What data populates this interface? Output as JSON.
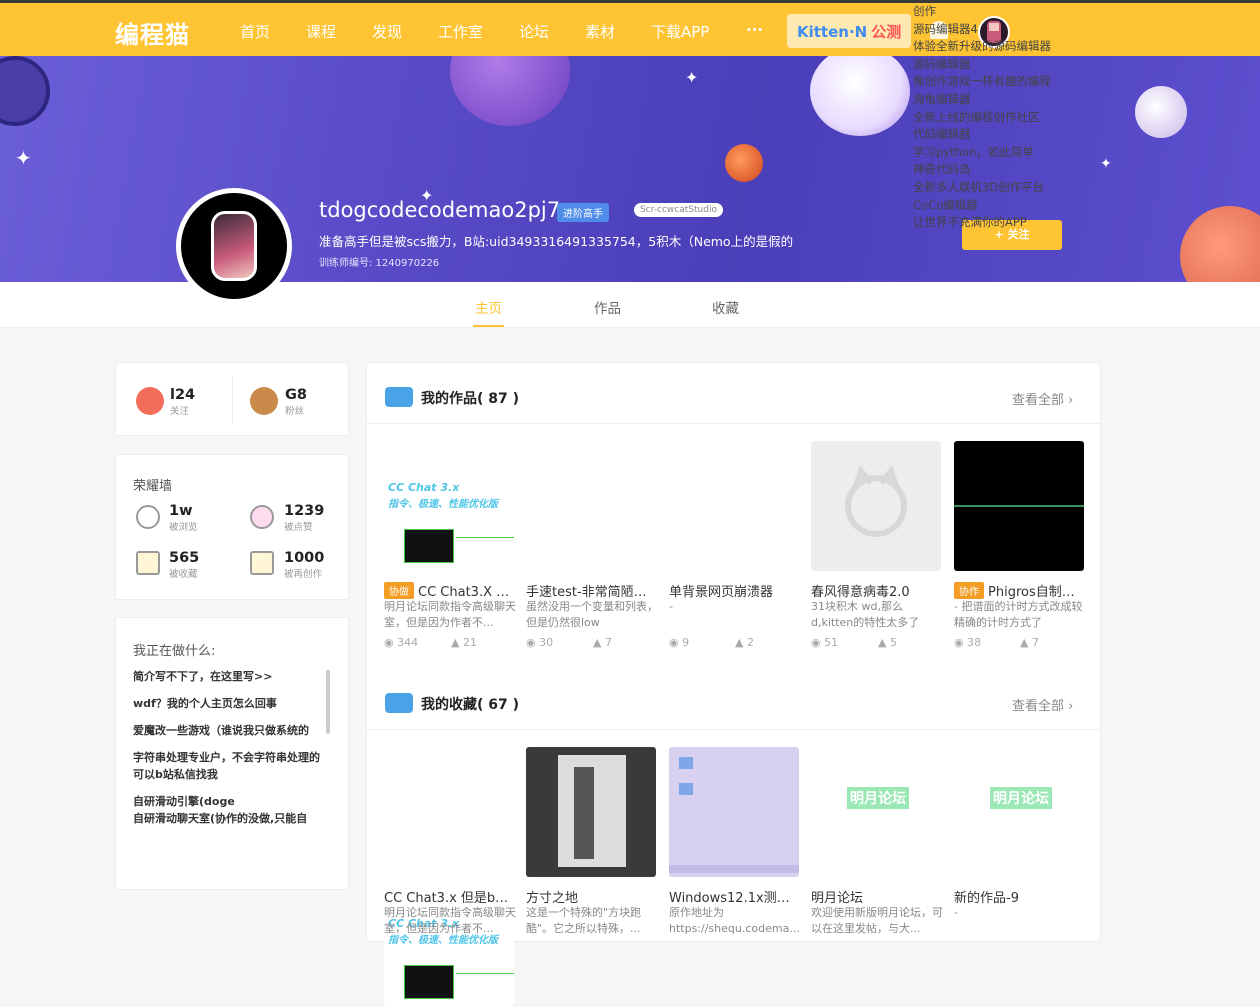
{
  "nav": {
    "logo": "编程猫",
    "items": [
      "首页",
      "课程",
      "发现",
      "工作室",
      "论坛",
      "素材",
      "下载APP",
      "···"
    ],
    "kitten": "Kitten·N",
    "kitten_tag": "公测"
  },
  "dropdown": [
    "创作",
    "源码编辑器4",
    "体验全新升级的源码编辑器",
    "源码编辑器",
    "像创作游戏一样有趣的编程",
    "海龟编辑器",
    "全新上线的编程创作社区",
    "代码编辑器",
    "学习python，如此简单",
    "神奇代码岛",
    "全新多人联机3D创作平台",
    "CoCo编辑器",
    "让世界不充满你的APP"
  ],
  "profile": {
    "username": "tdogcodecodemao2pj7",
    "level_badge": "进阶高手",
    "studio_badge": "Scr-ccwcatStudio",
    "motto": "准备高手但是被scs搬力，B站:uid3493316491335754，5积木（Nemo上的是假的",
    "trainer_id": "训练师编号: 1240970226",
    "follow_btn": "+ 关注"
  },
  "tabs": [
    "主页",
    "作品",
    "收藏"
  ],
  "follow_stats": {
    "following": {
      "num": "l24",
      "label": "关注"
    },
    "fans": {
      "num": "G8",
      "label": "粉丝"
    }
  },
  "honor": {
    "title": "荣耀墙",
    "items": [
      {
        "num": "1w",
        "label": "被浏览"
      },
      {
        "num": "1239",
        "label": "被点赞"
      },
      {
        "num": "565",
        "label": "被收藏"
      },
      {
        "num": "1000",
        "label": "被再创作"
      }
    ]
  },
  "doing": {
    "title": "我正在做什么:",
    "items": [
      "简介写不下了，在这里写>>",
      "wdf？我的个人主页怎么回事",
      "爱魔改一些游戏（谁说我只做系统的",
      "字符串处理专业户，不会字符串处理的可以b站私信找我",
      "自研滑动引擎(doge",
      "自研滑动聊天室(协作的没做,只能自"
    ]
  },
  "works": {
    "title": "我的作品( 87 )",
    "view_all": "查看全部",
    "items": [
      {
        "tag": "协做",
        "title": "CC Chat3.X 但...",
        "desc": "明月论坛同款指令高级聊天室，但是因为作者不...",
        "views": "344",
        "likes": "21",
        "cc1": "CC Chat 3.x",
        "cc2": "指令、极速、性能优化版"
      },
      {
        "tag": "",
        "title": "手速test-非常简陋且...",
        "desc": "虽然没用一个变量和列表，但是仍然很low",
        "views": "30",
        "likes": "7"
      },
      {
        "tag": "",
        "title": "单背景网页崩溃器",
        "desc": "-",
        "views": "9",
        "likes": "2"
      },
      {
        "tag": "",
        "title": "春风得意病毒2.0",
        "desc": "31块积木 wd,那么d,kitten的特性太多了",
        "views": "51",
        "likes": "5"
      },
      {
        "tag": "协作",
        "title": "Phigros自制烂...",
        "desc": "- 把谱面的计时方式改成较精确的计时方式了",
        "views": "38",
        "likes": "7"
      }
    ]
  },
  "favs": {
    "title": "我的收藏( 67 )",
    "view_all": "查看全部",
    "items": [
      {
        "title": "CC Chat3.x 但是bug...",
        "desc": "明月论坛同款指令高级聊天室，但是因为作者不...",
        "cc1": "CC Chat 3.x",
        "cc2": "指令、极速、性能优化版"
      },
      {
        "title": "方寸之地",
        "desc": "这是一个特殊的\"方块跑酷\"。它之所以特殊，..."
      },
      {
        "title": "Windows12.1x测试...",
        "desc": "原作地址为https://shequ.codema..."
      },
      {
        "title": "明月论坛",
        "desc": "欢迎使用新版明月论坛，可以在这里发帖，与大...",
        "thumb_text": "明月论坛"
      },
      {
        "title": "新的作品-9",
        "desc": "-",
        "thumb_text": "明月论坛"
      }
    ]
  }
}
